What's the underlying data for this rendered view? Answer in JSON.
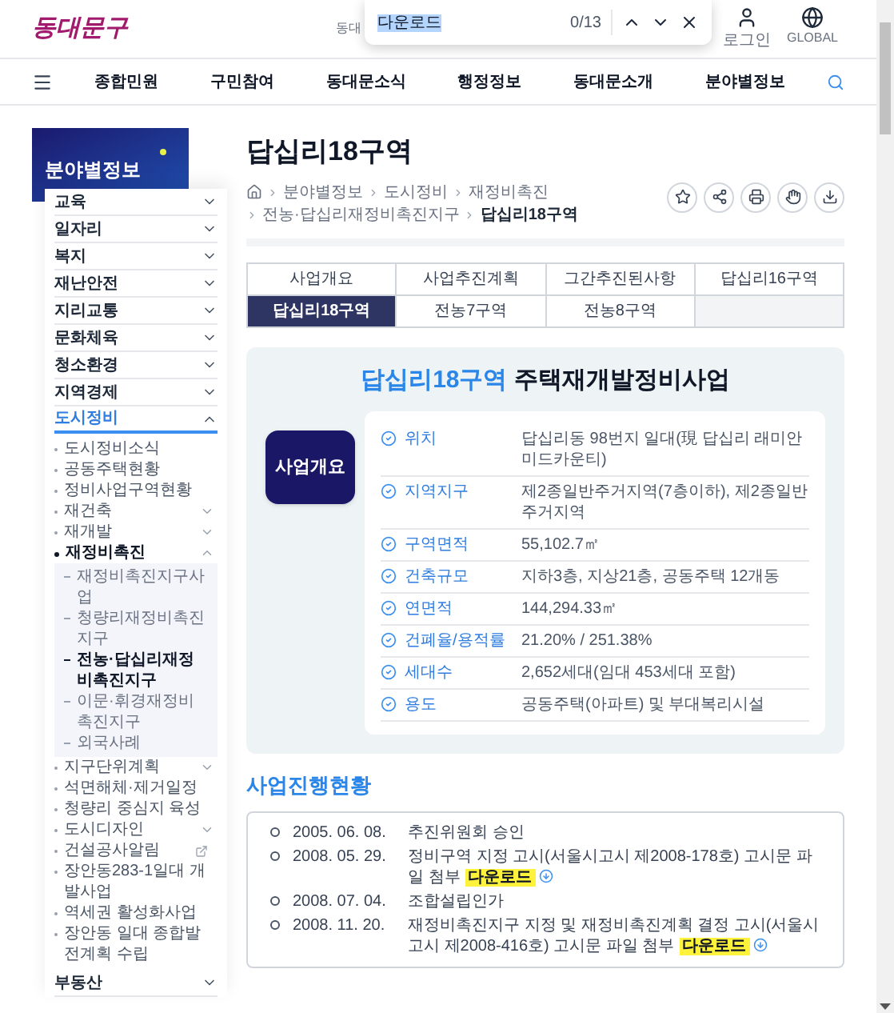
{
  "header": {
    "logo": "동대문구",
    "partial_text": "동대",
    "login_label": "로그인",
    "global_label": "GLOBAL"
  },
  "find_bar": {
    "query": "다운로드",
    "count": "0/13"
  },
  "nav": {
    "items": [
      "종합민원",
      "구민참여",
      "동대문소식",
      "행정정보",
      "동대문소개",
      "분야별정보"
    ]
  },
  "sidebar": {
    "title": "분야별정보",
    "items": [
      {
        "label": "교육",
        "selected": false,
        "expanded": false
      },
      {
        "label": "일자리",
        "selected": false,
        "expanded": false
      },
      {
        "label": "복지",
        "selected": false,
        "expanded": false
      },
      {
        "label": "재난안전",
        "selected": false,
        "expanded": false
      },
      {
        "label": "지리교통",
        "selected": false,
        "expanded": false
      },
      {
        "label": "문화체육",
        "selected": false,
        "expanded": false
      },
      {
        "label": "청소환경",
        "selected": false,
        "expanded": false
      },
      {
        "label": "지역경제",
        "selected": false,
        "expanded": false
      },
      {
        "label": "도시정비",
        "selected": true,
        "expanded": true,
        "children": [
          {
            "label": "도시정비소식",
            "selected": false
          },
          {
            "label": "공동주택현황",
            "selected": false
          },
          {
            "label": "정비사업구역현황",
            "selected": false
          },
          {
            "label": "재건축",
            "selected": false,
            "expanded": false
          },
          {
            "label": "재개발",
            "selected": false,
            "expanded": false
          },
          {
            "label": "재정비촉진",
            "selected": true,
            "expanded": true,
            "children": [
              {
                "label": "재정비촉진지구사업",
                "selected": false
              },
              {
                "label": "청량리재정비촉진지구",
                "selected": false
              },
              {
                "label": "전농·답십리재정비촉진지구",
                "selected": true
              },
              {
                "label": "이문·휘경재정비촉진지구",
                "selected": false
              },
              {
                "label": "외국사례",
                "selected": false
              }
            ]
          },
          {
            "label": "지구단위계획",
            "selected": false,
            "expanded": false
          },
          {
            "label": "석면해체·제거일정",
            "selected": false
          },
          {
            "label": "청량리 중심지 육성",
            "selected": false
          },
          {
            "label": "도시디자인",
            "selected": false,
            "expanded": false
          },
          {
            "label": "건설공사알림",
            "selected": false,
            "external": true
          },
          {
            "label": "장안동283-1일대 개발사업",
            "selected": false
          },
          {
            "label": "역세권 활성화사업",
            "selected": false
          },
          {
            "label": "장안동 일대 종합발전계획 수립",
            "selected": false
          }
        ]
      },
      {
        "label": "부동산",
        "selected": false,
        "expanded": false
      }
    ]
  },
  "page": {
    "title": "답십리18구역",
    "breadcrumb": [
      "분야별정보",
      "도시정비",
      "재정비촉진",
      "전농·답십리재정비촉진지구",
      "답십리18구역"
    ]
  },
  "tabs": [
    {
      "label": "사업개요",
      "selected": false
    },
    {
      "label": "사업추진계획",
      "selected": false
    },
    {
      "label": "그간추진된사항",
      "selected": false
    },
    {
      "label": "답십리16구역",
      "selected": false
    },
    {
      "label": "답십리18구역",
      "selected": true
    },
    {
      "label": "전농7구역",
      "selected": false
    },
    {
      "label": "전농8구역",
      "selected": false
    }
  ],
  "summary": {
    "heading_highlight": "답십리18구역",
    "heading_rest": "주택재개발정비사업",
    "badge": "사업개요",
    "rows": [
      {
        "label": "위치",
        "value": "답십리동 98번지 일대(現 답십리 래미안미드카운티)"
      },
      {
        "label": "지역지구",
        "value": "제2종일반주거지역(7층이하), 제2종일반주거지역"
      },
      {
        "label": "구역면적",
        "value": "55,102.7㎡"
      },
      {
        "label": "건축규모",
        "value": "지하3층, 지상21층, 공동주택 12개동"
      },
      {
        "label": "연면적",
        "value": "144,294.33㎡"
      },
      {
        "label": "건폐율/용적률",
        "value": "21.20% / 251.38%"
      },
      {
        "label": "세대수",
        "value": "2,652세대(임대 453세대 포함)"
      },
      {
        "label": "용도",
        "value": "공동주택(아파트) 및 부대복리시설"
      }
    ]
  },
  "progress": {
    "title": "사업진행현황",
    "items": [
      {
        "date": "2005. 06. 08.",
        "text": "추진위원회 승인"
      },
      {
        "date": "2008. 05. 29.",
        "text": "정비구역 지정 고시(서울시고시 제2008-178호) 고시문 파일 첨부",
        "download": "다운로드"
      },
      {
        "date": "2008. 07. 04.",
        "text": "조합설립인가"
      },
      {
        "date": "2008. 11. 20.",
        "text": "재정비촉진지구 지정 및 재정비촉진계획 결정 고시(서울시고시 제2008-416호) 고시문 파일 첨부",
        "download": "다운로드"
      }
    ]
  }
}
